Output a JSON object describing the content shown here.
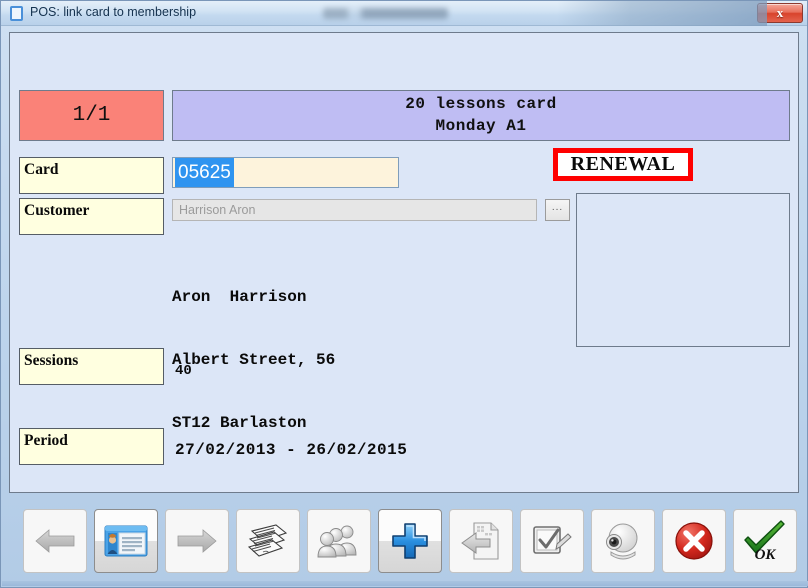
{
  "window": {
    "title": "POS: link card to membership",
    "title_icon": "document-icon",
    "close_label": "x",
    "background_color": "#dce6f7",
    "titlebar_gradient_top": "#e4eff9"
  },
  "header": {
    "counter": "1/1",
    "counter_color": "#fa8278",
    "card_title_line1": "20 lessons card",
    "card_title_line2": "Monday A1",
    "card_title_color": "#bfbdf3"
  },
  "badge": {
    "renewal_label": "RENEWAL",
    "border_color": "#ff0000",
    "text_color": "#0a0a0a"
  },
  "fields": {
    "card": {
      "label": "Card",
      "value": "05625",
      "selected": true,
      "selection_color": "#2f94f0",
      "input_background": "#fdf3dc"
    },
    "customer": {
      "label": "Customer",
      "value": "Harrison Aron",
      "placeholder": "Harrison Aron",
      "disabled": true,
      "browse_label": "..."
    },
    "sessions": {
      "label": "Sessions",
      "value": "40"
    },
    "period": {
      "label": "Period",
      "value": "27/02/2013 - 26/02/2015"
    }
  },
  "address": {
    "line1": "Aron  Harrison",
    "line2": "Albert Street, 56",
    "line3": "ST12 Barlaston"
  },
  "photo": {
    "placeholder_empty": true
  },
  "toolbar": {
    "buttons": [
      {
        "name": "previous-button",
        "icon": "arrow-left-icon",
        "label": "Previous",
        "style": "flat"
      },
      {
        "name": "card-details-button",
        "icon": "id-card-icon",
        "label": "Card details",
        "style": "raised"
      },
      {
        "name": "next-button",
        "icon": "arrow-right-icon",
        "label": "Next",
        "style": "flat"
      },
      {
        "name": "documents-button",
        "icon": "documents-icon",
        "label": "Documents",
        "style": "flat"
      },
      {
        "name": "members-button",
        "icon": "people-group-icon",
        "label": "Members",
        "style": "flat"
      },
      {
        "name": "add-button",
        "icon": "plus-icon",
        "label": "Add",
        "style": "raised"
      },
      {
        "name": "export-button",
        "icon": "export-document-icon",
        "label": "Export",
        "style": "flat"
      },
      {
        "name": "approve-button",
        "icon": "checkbox-pen-icon",
        "label": "Approve",
        "style": "flat"
      },
      {
        "name": "webcam-button",
        "icon": "webcam-icon",
        "label": "Webcam",
        "style": "flat"
      },
      {
        "name": "cancel-button",
        "icon": "red-x-circle-icon",
        "label": "Cancel",
        "style": "flat"
      },
      {
        "name": "ok-button",
        "icon": "green-check-icon",
        "label": "OK",
        "style": "flat"
      }
    ],
    "ok_text": "OK"
  }
}
